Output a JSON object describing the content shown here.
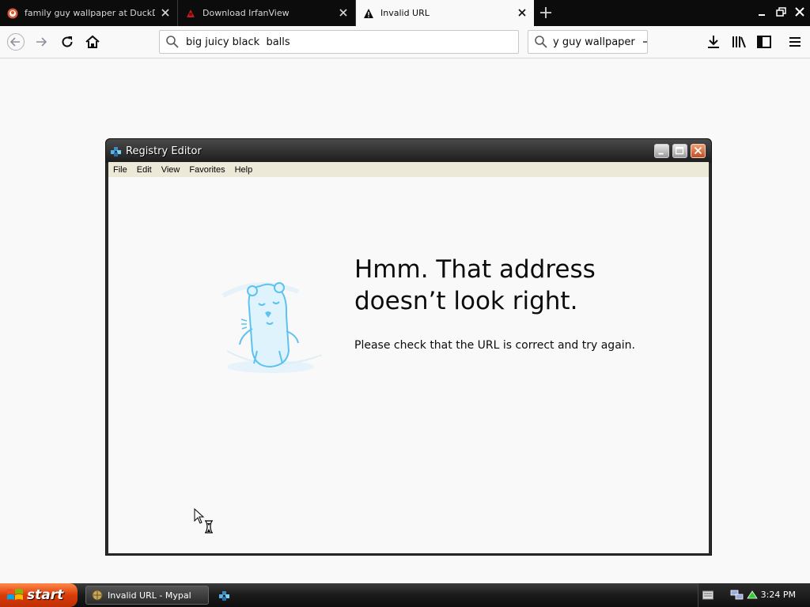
{
  "tabs": [
    {
      "title": "family guy wallpaper at DuckDuckGo",
      "icon": "duckduckgo-icon",
      "active": false
    },
    {
      "title": "Download IrfanView",
      "icon": "irfanview-icon",
      "active": false
    },
    {
      "title": "Invalid URL",
      "icon": "warning-icon",
      "active": true
    }
  ],
  "navbar": {
    "url_text": "big juicy black  balls",
    "search_text": "y guy wallpaper"
  },
  "registry_window": {
    "title": "Registry Editor",
    "menu": [
      "File",
      "Edit",
      "View",
      "Favorites",
      "Help"
    ]
  },
  "error_page": {
    "title_line1": "Hmm. That address",
    "title_line2": "doesn’t look right.",
    "description": "Please check that the URL is correct and try again."
  },
  "taskbar": {
    "start_label": "start",
    "task_label": "Invalid URL - Mypal",
    "clock": "3:24 PM"
  },
  "colors": {
    "tabstrip_bg": "#0c0c0d",
    "page_bg": "#f9f9fa",
    "start_orange": "#d93c0a",
    "mascot_blue": "#5cc3f0"
  }
}
